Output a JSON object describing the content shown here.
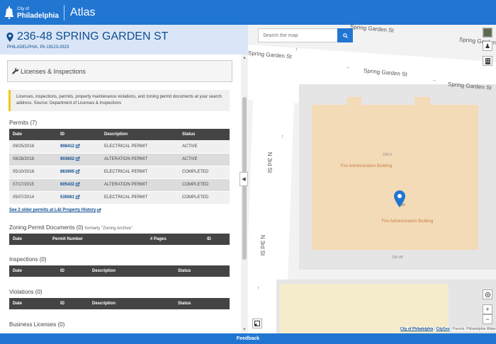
{
  "header": {
    "city_of": "City of",
    "city_name": "Philadelphia",
    "app_title": "Atlas"
  },
  "address": {
    "main": "236-48 SPRING GARDEN ST",
    "sub": "PHILADELPHIA, PA 19123-2923"
  },
  "topic": {
    "label": "Licenses & Inspections",
    "intro": "Licenses, inspections, permits, property maintenance violations, and zoning permit documents at your search address. Source: Department of Licenses & Inspections"
  },
  "permits": {
    "title": "Permits (7)",
    "headers": [
      "Date",
      "ID",
      "Description",
      "Status"
    ],
    "rows": [
      {
        "date": "09/25/2018",
        "id": "908412",
        "description": "ELECTRICAL PERMIT",
        "status": "ACTIVE"
      },
      {
        "date": "08/28/2018",
        "id": "903602",
        "description": "ALTERATION PERMIT",
        "status": "ACTIVE"
      },
      {
        "date": "05/10/2018",
        "id": "863995",
        "description": "ELECTRICAL PERMIT",
        "status": "COMPLETED"
      },
      {
        "date": "07/17/2015",
        "id": "605432",
        "description": "ALTERATION PERMIT",
        "status": "COMPLETED"
      },
      {
        "date": "05/07/2014",
        "id": "535061",
        "description": "ELECTRICAL PERMIT",
        "status": "COMPLETED"
      }
    ],
    "more_link": "See 2 older permits at L&I Property History"
  },
  "zoning": {
    "title": "Zoning Permit Documents (0)",
    "subtitle": "formerly \"Zoning Archive\"",
    "headers": [
      "Date",
      "Permit Number",
      "# Pages",
      "ID"
    ]
  },
  "inspections": {
    "title": "Inspections (0)",
    "headers": [
      "Date",
      "ID",
      "Description",
      "Status"
    ]
  },
  "violations": {
    "title": "Violations (0)",
    "headers": [
      "Date",
      "ID",
      "Description",
      "Status"
    ]
  },
  "business": {
    "title": "Business Licenses (0)"
  },
  "map": {
    "search_placeholder": "Search the map",
    "street_spring_garden": "Spring Garden St",
    "street_n3rd": "N 3rd St",
    "building_name": "Fire Administration Building",
    "addr_num_top": "236-8",
    "addr_num_bottom": "236-48",
    "attribution_city": "City of Philadelphia",
    "attribution_sep": " | ",
    "attribution_citygeo": "CityGeo",
    "attribution_rest": " | Parcels: Philadelphia Water"
  },
  "footer": {
    "label": "Feedback"
  },
  "colors": {
    "brand_blue": "#2176d2",
    "dark_blue": "#0f4d90",
    "address_bg": "#dae6f7",
    "warning_yellow": "#f3c613",
    "building": "#f4dbb7"
  }
}
